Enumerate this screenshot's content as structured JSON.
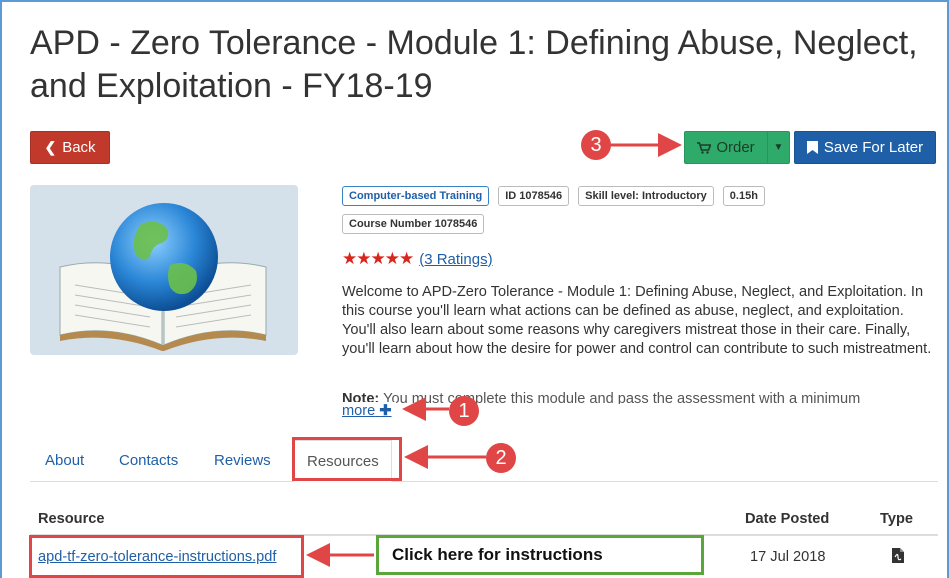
{
  "title": "APD - Zero Tolerance - Module 1: Defining Abuse, Neglect, and Exploitation - FY18-19",
  "toolbar": {
    "back_label": "Back",
    "order_label": "Order",
    "save_label": "Save For Later"
  },
  "tags": [
    "Computer-based Training",
    "ID 1078546",
    "Skill level: Introductory",
    "0.15h",
    "Course Number 1078546"
  ],
  "rating": {
    "stars": 5,
    "stars_text": "★★★★★",
    "link": "(3 Ratings)"
  },
  "description": "Welcome to APD-Zero Tolerance - Module 1: Defining Abuse, Neglect, and Exploitation. In this course you'll learn what actions can be defined as abuse, neglect, and exploitation. You'll also learn about some reasons why caregivers mistreat those in their care. Finally, you'll learn about how the desire for power and control can contribute to such mistreatment.",
  "note": {
    "label": "Note:",
    "text": "You must complete this module and pass the assessment with a minimum"
  },
  "more_label": "more",
  "tabs": [
    "About",
    "Contacts",
    "Reviews",
    "Resources"
  ],
  "active_tab": "Resources",
  "table": {
    "headers": [
      "Resource",
      "Date Posted",
      "Type"
    ],
    "rows": [
      {
        "resource": "apd-tf-zero-tolerance-instructions.pdf",
        "date": "17 Jul 2018",
        "type_icon": "pdf-file-icon"
      }
    ]
  },
  "annotations": {
    "callout": "Click here for instructions",
    "badges": [
      "1",
      "2",
      "3"
    ]
  },
  "colors": {
    "back": "#c0392b",
    "order": "#2eab6a",
    "save": "#1f5fa8",
    "annotation_red": "#e04646",
    "annotation_green": "#5aa63a",
    "link": "#1f5fa8"
  },
  "icons": {
    "back": "chevron-left-icon",
    "order": "shopping-cart-icon",
    "dropdown": "caret-down-icon",
    "save": "bookmark-icon",
    "more": "plus-icon",
    "thumbnail": "globe-book-icon"
  }
}
